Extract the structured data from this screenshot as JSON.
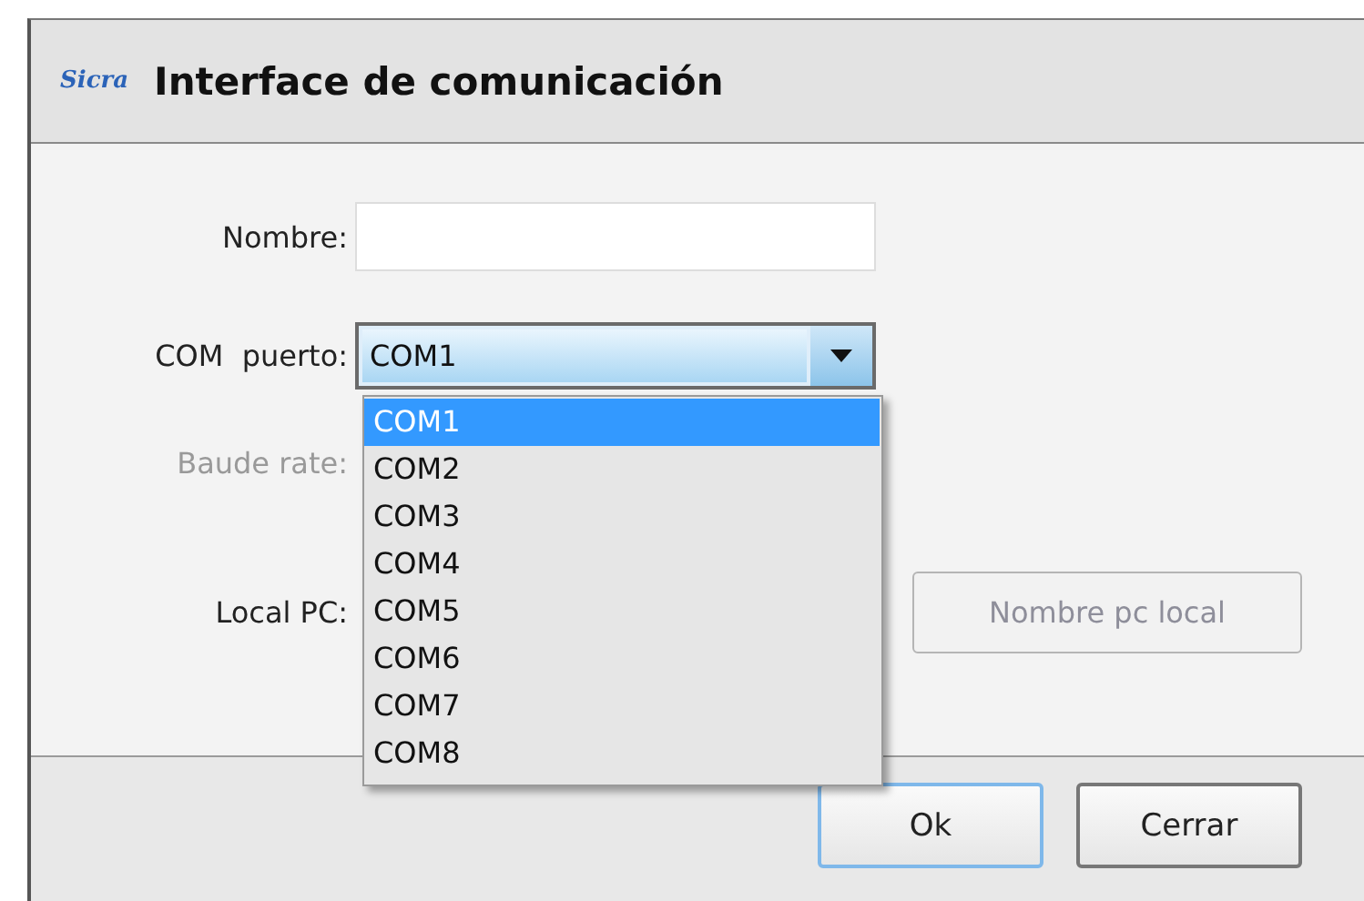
{
  "window": {
    "logo": "Sicra",
    "title": "Interface de comunicación"
  },
  "form": {
    "rows": [
      {
        "kind": "text",
        "label": "Nombre:",
        "disabled": false
      },
      {
        "kind": "combo",
        "label": "COM  puerto:",
        "value": "COM1",
        "expanded": true,
        "disabled": false
      },
      {
        "kind": "covered",
        "label": "Baude rate:",
        "disabled": true
      },
      {
        "kind": "covered-button",
        "label": "Local PC:",
        "disabled": false,
        "button": {
          "label": "Nombre pc local",
          "disabled": true
        }
      }
    ]
  },
  "dropdown": {
    "options": [
      {
        "label": "COM1",
        "selected": true
      },
      {
        "label": "COM2",
        "selected": false
      },
      {
        "label": "COM3",
        "selected": false
      },
      {
        "label": "COM4",
        "selected": false
      },
      {
        "label": "COM5",
        "selected": false
      },
      {
        "label": "COM6",
        "selected": false
      },
      {
        "label": "COM7",
        "selected": false
      },
      {
        "label": "COM8",
        "selected": false
      }
    ]
  },
  "buttons": [
    {
      "label": "Ok",
      "default": true
    },
    {
      "label": "Cerrar",
      "default": false
    }
  ]
}
